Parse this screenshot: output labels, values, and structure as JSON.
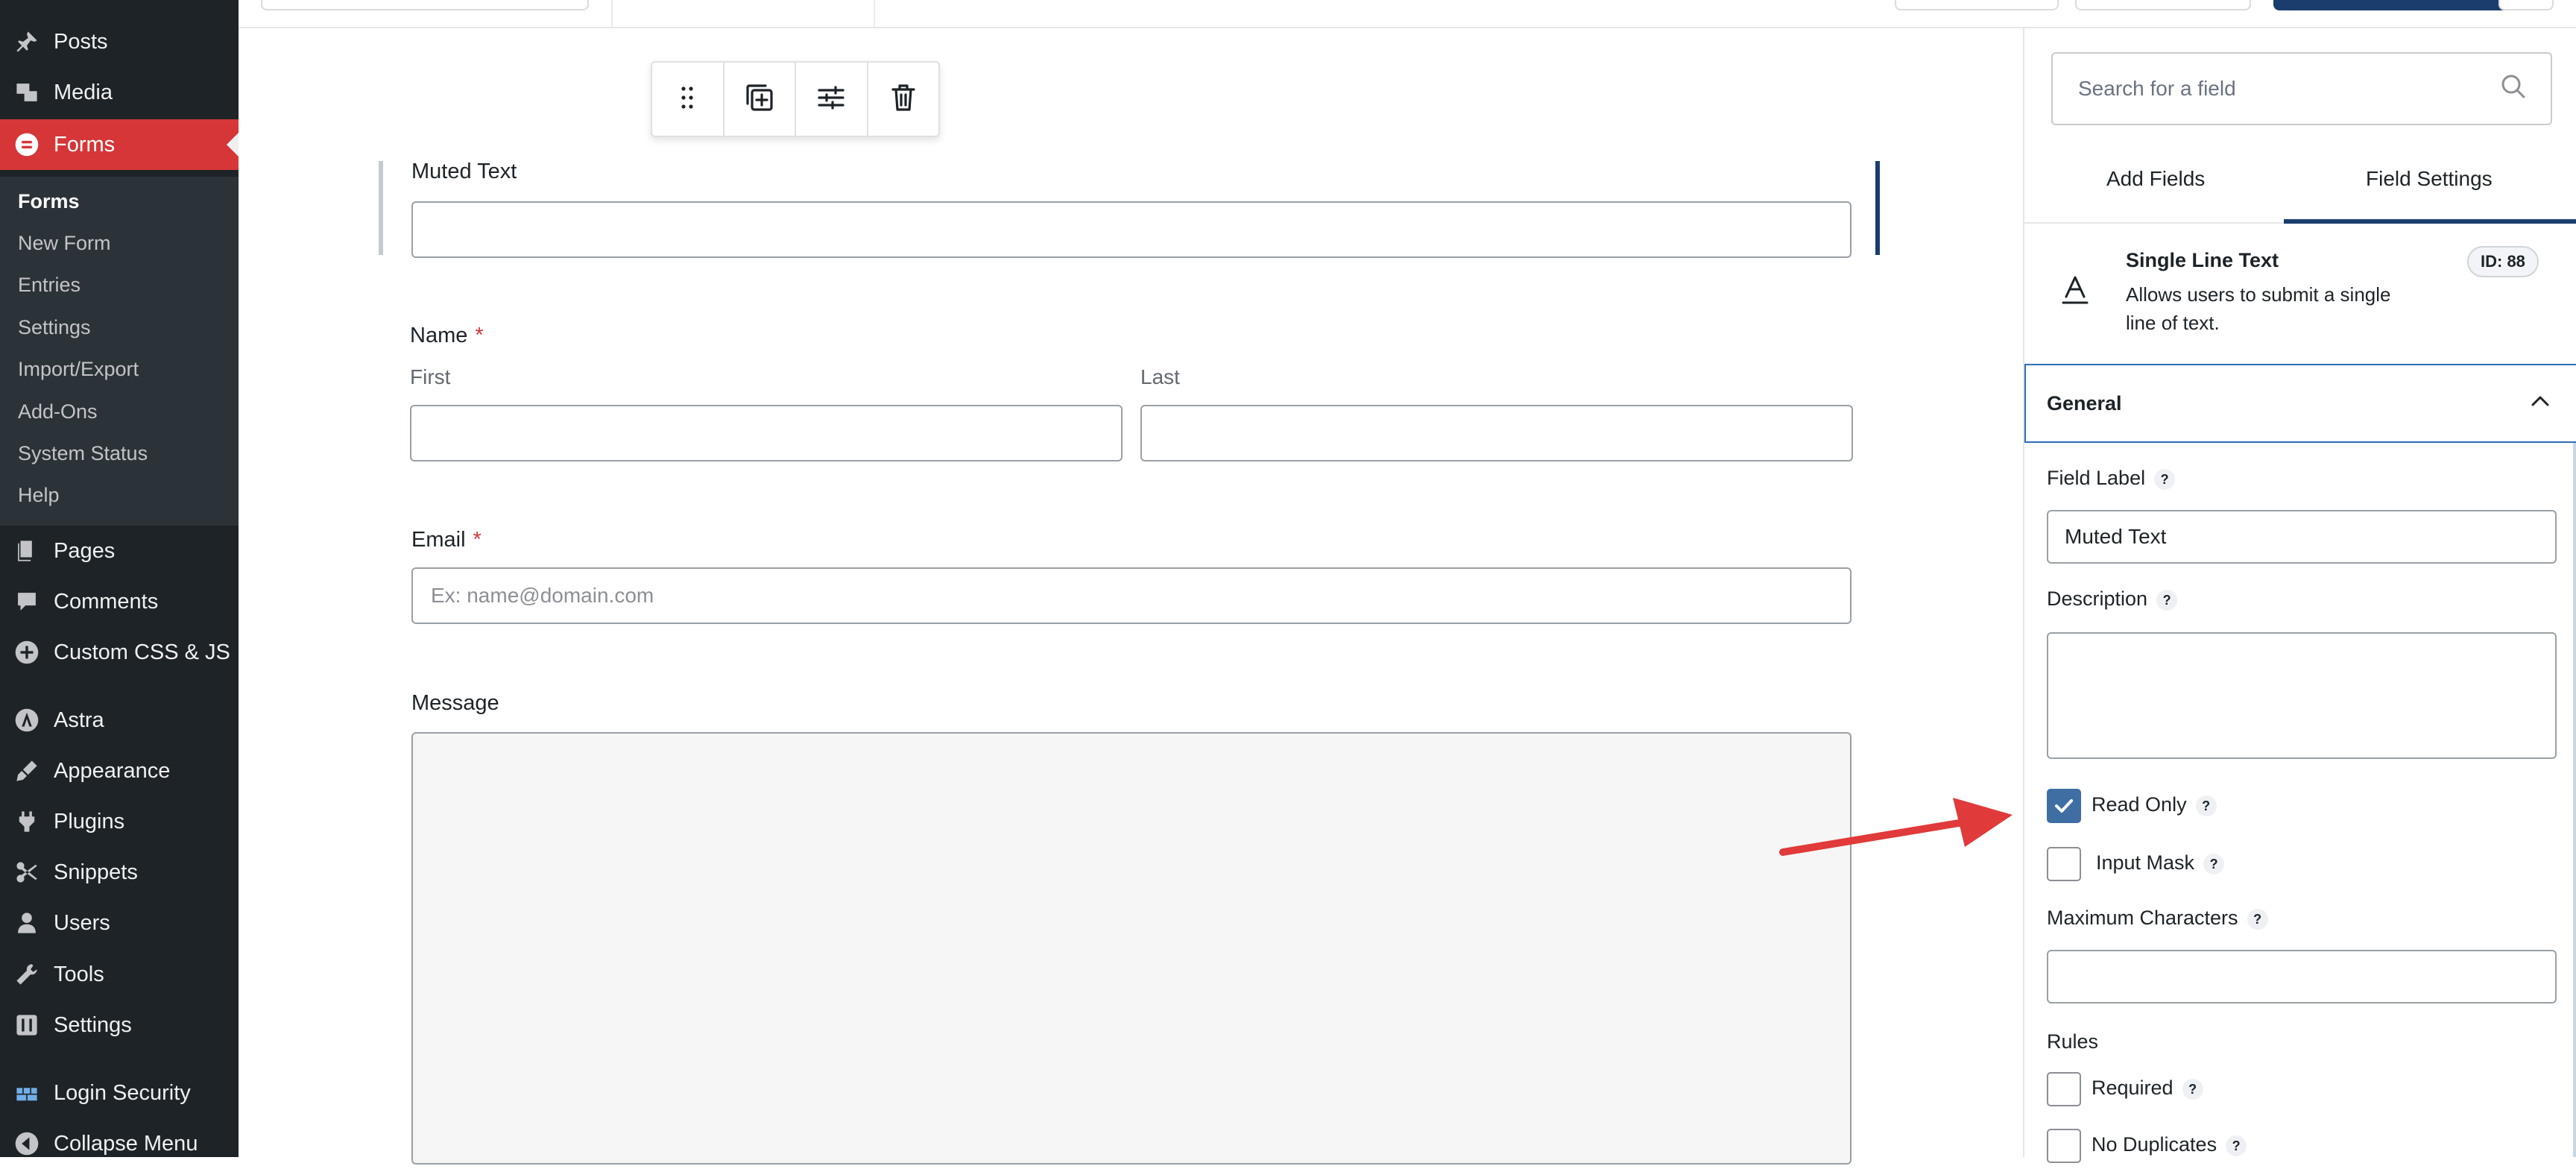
{
  "sidebar": {
    "items_top": [
      {
        "label": "Posts",
        "icon": "pin-icon"
      },
      {
        "label": "Media",
        "icon": "media-icon"
      },
      {
        "label": "Forms",
        "icon": "forms-icon",
        "active": true
      }
    ],
    "submenu": [
      {
        "label": "Forms",
        "current": true
      },
      {
        "label": "New Form"
      },
      {
        "label": "Entries"
      },
      {
        "label": "Settings"
      },
      {
        "label": "Import/Export"
      },
      {
        "label": "Add-Ons"
      },
      {
        "label": "System Status"
      },
      {
        "label": "Help"
      }
    ],
    "items_bottom": [
      {
        "label": "Pages",
        "icon": "pages-icon"
      },
      {
        "label": "Comments",
        "icon": "comments-icon"
      },
      {
        "label": "Custom CSS & JS",
        "icon": "plus-circle-icon"
      },
      {
        "label": "Astra",
        "icon": "astra-icon"
      },
      {
        "label": "Appearance",
        "icon": "brush-icon"
      },
      {
        "label": "Plugins",
        "icon": "plugin-icon"
      },
      {
        "label": "Snippets",
        "icon": "scissors-icon"
      },
      {
        "label": "Users",
        "icon": "user-icon"
      },
      {
        "label": "Tools",
        "icon": "wrench-icon"
      },
      {
        "label": "Settings",
        "icon": "sliders-icon"
      },
      {
        "label": "Login Security",
        "icon": "wall-icon"
      },
      {
        "label": "Collapse Menu",
        "icon": "collapse-icon"
      }
    ],
    "colors": {
      "bg": "#1d2327",
      "active": "#d63638",
      "submenu_bg": "#2c3338"
    }
  },
  "toolbar": {
    "icons": [
      "drag-handle-icon",
      "duplicate-icon",
      "settings-sliders-icon",
      "trash-icon"
    ]
  },
  "form": {
    "muted_text": {
      "label": "Muted Text",
      "value": ""
    },
    "name": {
      "label": "Name",
      "required_mark": "*",
      "first_label": "First",
      "last_label": "Last"
    },
    "email": {
      "label": "Email",
      "required_mark": "*",
      "placeholder": "Ex: name@domain.com"
    },
    "message": {
      "label": "Message"
    }
  },
  "panel": {
    "search_placeholder": "Search for a field",
    "tabs": {
      "add_fields": "Add Fields",
      "field_settings": "Field Settings"
    },
    "field_type": {
      "title": "Single Line Text",
      "description_line1": "Allows users to submit a single",
      "description_line2": "line of text.",
      "id_badge": "ID: 88"
    },
    "general": "General",
    "field_label": {
      "label": "Field Label",
      "value": "Muted Text",
      "help": "?"
    },
    "description": {
      "label": "Description",
      "value": "",
      "help": "?"
    },
    "read_only": {
      "label": "Read Only",
      "checked": true,
      "help": "?"
    },
    "input_mask": {
      "label": "Input Mask",
      "checked": false,
      "help": "?"
    },
    "max_chars": {
      "label": "Maximum Characters",
      "value": "",
      "help": "?"
    },
    "rules": "Rules",
    "required": {
      "label": "Required",
      "checked": false,
      "help": "?"
    },
    "no_duplicates": {
      "label": "No Duplicates",
      "checked": false,
      "help": "?"
    }
  },
  "annotation": {
    "color": "#e03a3a"
  }
}
